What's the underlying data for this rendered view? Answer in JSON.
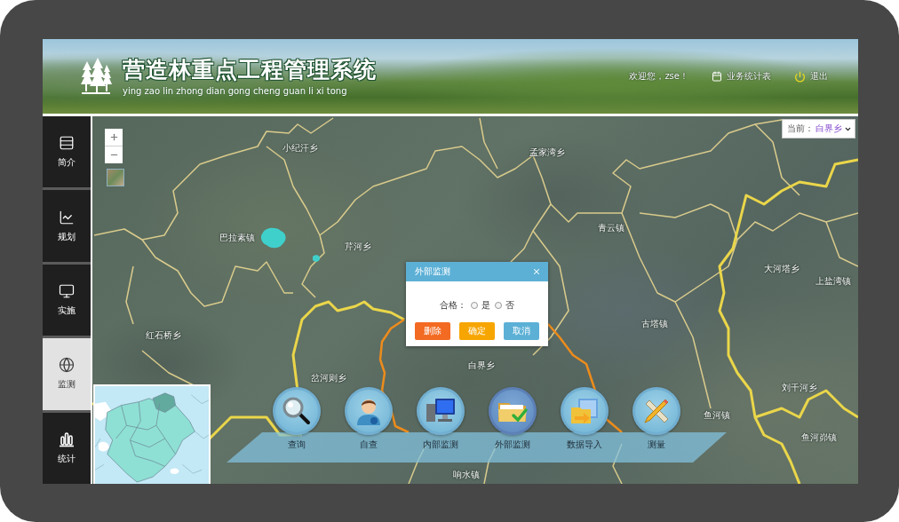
{
  "header": {
    "title": "营造林重点工程管理系统",
    "subtitle": "ying zao lin zhong dian gong cheng guan li xi tong",
    "greeting": "欢迎您，zse！",
    "links": [
      {
        "kind": "report",
        "label": "业务统计表"
      },
      {
        "kind": "logout",
        "label": "退出"
      }
    ]
  },
  "sidebar": {
    "items": [
      {
        "kind": "intro",
        "label": "简介",
        "selected": false
      },
      {
        "kind": "plan",
        "label": "规划",
        "selected": false
      },
      {
        "kind": "implement",
        "label": "实施",
        "selected": false
      },
      {
        "kind": "monitor",
        "label": "监测",
        "selected": true
      },
      {
        "kind": "stats",
        "label": "统计",
        "selected": false
      }
    ]
  },
  "map": {
    "area_selector": {
      "label": "当前：",
      "value": "白界乡"
    },
    "labels": [
      "小纪汗乡",
      "孟家湾乡",
      "青云镇",
      "巴拉素镇",
      "芹河乡",
      "大河塔乡",
      "上盐湾镇",
      "古塔镇",
      "红石桥乡",
      "白界乡",
      "岔河则乡",
      "刘千河乡",
      "鱼河镇",
      "鱼河峁镇",
      "响水镇"
    ]
  },
  "dialog": {
    "title": "外部监测",
    "field_label": "合格：",
    "options": [
      {
        "label": "是",
        "selected": false
      },
      {
        "label": "否",
        "selected": false
      }
    ],
    "buttons": [
      {
        "kind": "danger",
        "label": "删除"
      },
      {
        "kind": "warning",
        "label": "确定"
      },
      {
        "kind": "primary",
        "label": "取消"
      }
    ]
  },
  "toolbar": {
    "tools": [
      {
        "kind": "query",
        "label": "查询",
        "selected": false
      },
      {
        "kind": "self_check",
        "label": "自查",
        "selected": false
      },
      {
        "kind": "internal",
        "label": "内部监测",
        "selected": false
      },
      {
        "kind": "external",
        "label": "外部监测",
        "selected": true
      },
      {
        "kind": "import",
        "label": "数据导入",
        "selected": false
      },
      {
        "kind": "measure",
        "label": "测量",
        "selected": false
      }
    ]
  }
}
